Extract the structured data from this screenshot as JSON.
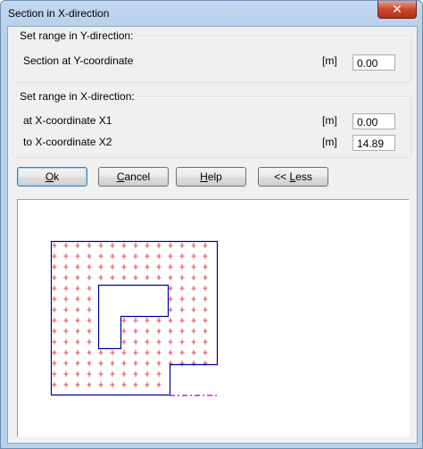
{
  "window": {
    "title": "Section in X-direction",
    "close_label": "✕"
  },
  "y_group": {
    "legend": "Set range in Y-direction:",
    "section_label": "Section at Y-coordinate",
    "unit": "[m]",
    "section_value": "0.00"
  },
  "x_group": {
    "legend": "Set range in X-direction:",
    "x1_label": "at X-coordinate X1",
    "x1_unit": "[m]",
    "x1_value": "0.00",
    "x2_label": "to X-coordinate X2",
    "x2_unit": "[m]",
    "x2_value": "14.89"
  },
  "buttons": {
    "ok_underline": "O",
    "ok_rest": "k",
    "cancel_underline": "C",
    "cancel_rest": "ancel",
    "help_underline": "H",
    "help_rest": "elp",
    "less_prefix": "<< ",
    "less_underline": "L",
    "less_rest": "ess"
  },
  "colors": {
    "outline": "#0000a0",
    "grid_marks": "#e0202a",
    "section_line": "#d020d0"
  }
}
